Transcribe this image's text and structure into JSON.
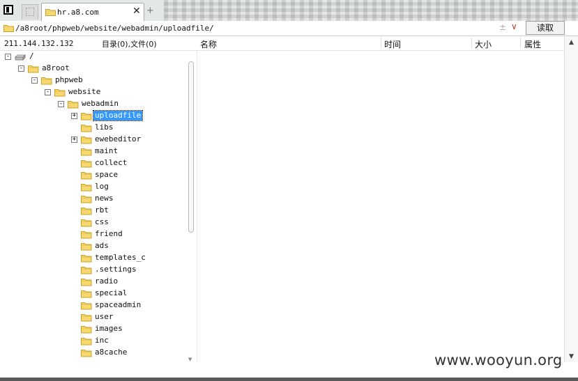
{
  "tab": {
    "title": "hr.a8.com",
    "close_icon": "close-icon",
    "new_tab_icon": "plus-icon"
  },
  "address": {
    "path": "/a8root/phpweb/website/webadmin/uploadfile/",
    "read_button": "读取"
  },
  "info": {
    "ip": "211.144.132.132",
    "dir_count": "目录(0),文件(0)"
  },
  "columns": {
    "name": "名称",
    "time": "时间",
    "size": "大小",
    "attr": "属性"
  },
  "tree": {
    "root": "/",
    "nodes": [
      {
        "label": "a8root",
        "toggle": "-"
      },
      {
        "label": "phpweb",
        "toggle": "-"
      },
      {
        "label": "website",
        "toggle": "-"
      },
      {
        "label": "webadmin",
        "toggle": "-"
      },
      {
        "label": "uploadfile",
        "toggle": "+",
        "selected": true
      },
      {
        "label": "libs"
      },
      {
        "label": "ewebeditor",
        "toggle": "+"
      },
      {
        "label": "maint"
      },
      {
        "label": "collect"
      },
      {
        "label": "space"
      },
      {
        "label": "log"
      },
      {
        "label": "news"
      },
      {
        "label": "rbt"
      },
      {
        "label": "css"
      },
      {
        "label": "friend"
      },
      {
        "label": "ads"
      },
      {
        "label": "templates_c"
      },
      {
        "label": ".settings"
      },
      {
        "label": "radio"
      },
      {
        "label": "special"
      },
      {
        "label": "spaceadmin"
      },
      {
        "label": "user"
      },
      {
        "label": "images"
      },
      {
        "label": "inc"
      },
      {
        "label": "a8cache"
      }
    ]
  },
  "watermark": "www.wooyun.org",
  "colors": {
    "selection": "#3399ff",
    "folder": "#f6d872",
    "folder_border": "#c9a227"
  }
}
